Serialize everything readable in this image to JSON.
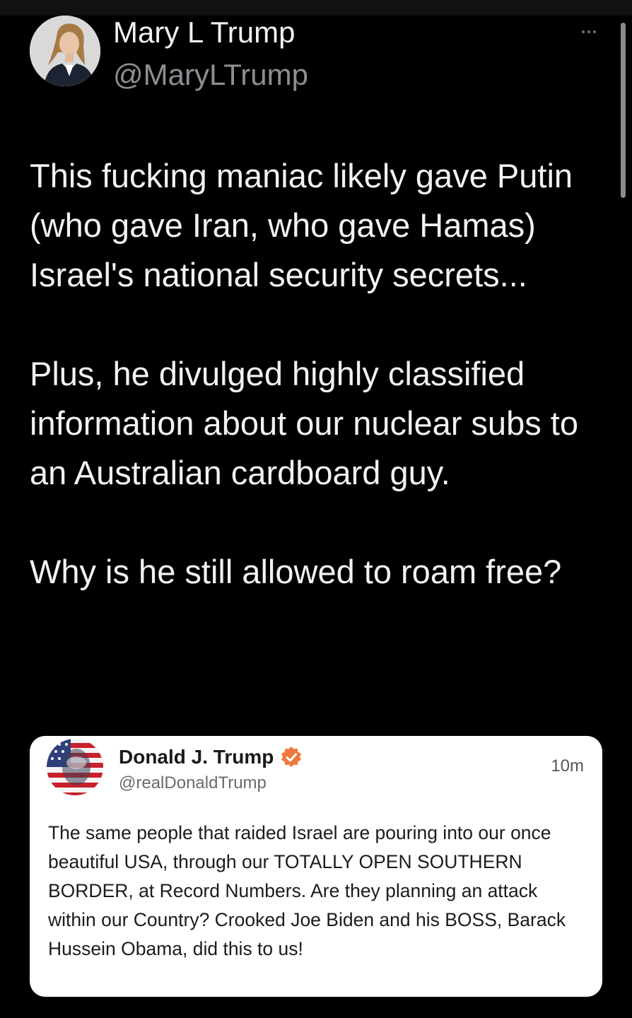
{
  "author": {
    "display_name": "Mary L Trump",
    "handle": "@MaryLTrump",
    "avatar_icon": "profile-photo"
  },
  "more_icon": "more-horizontal-icon",
  "tweet": {
    "paragraphs": [
      "This fucking maniac likely gave Putin (who gave Iran, who gave Hamas) Israel's national security secrets...",
      "Plus, he divulged highly classified information about our nuclear subs to an Australian cardboard guy.",
      "Why is he still allowed to roam free?"
    ]
  },
  "embed": {
    "display_name": "Donald J. Trump",
    "handle": "@realDonaldTrump",
    "timestamp": "10m",
    "verified_color": "#f0783c",
    "text": "The same people that raided Israel are pouring into our once beautiful USA, through our TOTALLY OPEN SOUTHERN BORDER, at Record Numbers. Are they planning an attack within our Country? Crooked Joe Biden and his BOSS, Barack Hussein Obama, did this to us!"
  },
  "colors": {
    "background": "#000000",
    "primary_text": "#f2f2f2",
    "secondary_text": "#8b8f93",
    "card_background": "#ffffff"
  }
}
